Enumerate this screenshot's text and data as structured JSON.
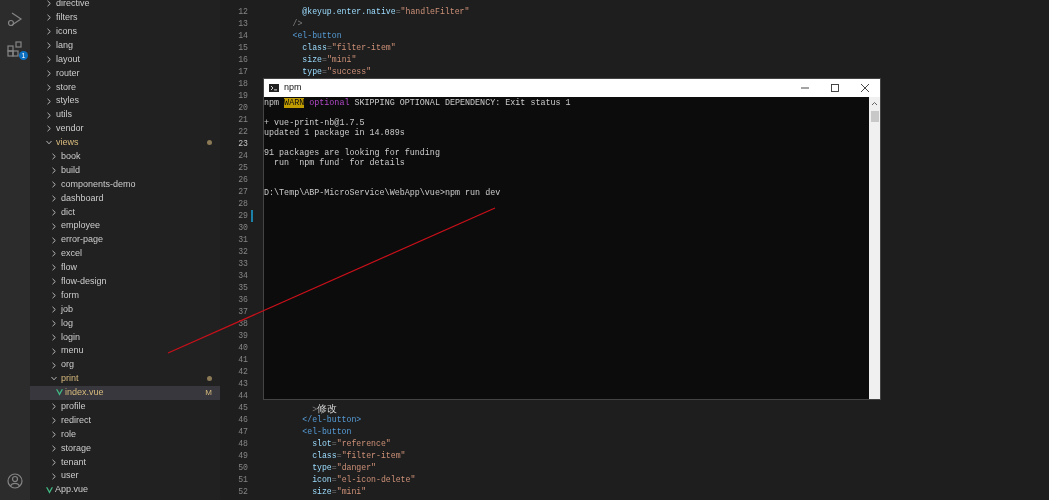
{
  "activity_bar": {
    "extensions_badge": "1"
  },
  "explorer": {
    "items": [
      {
        "kind": "folder",
        "label": "directive",
        "expanded": false,
        "selected": false,
        "modified": false
      },
      {
        "kind": "folder",
        "label": "filters",
        "expanded": false,
        "selected": false,
        "modified": false
      },
      {
        "kind": "folder",
        "label": "icons",
        "expanded": false,
        "selected": false,
        "modified": false
      },
      {
        "kind": "folder",
        "label": "lang",
        "expanded": false,
        "selected": false,
        "modified": false
      },
      {
        "kind": "folder",
        "label": "layout",
        "expanded": false,
        "selected": false,
        "modified": false
      },
      {
        "kind": "folder",
        "label": "router",
        "expanded": false,
        "selected": false,
        "modified": false
      },
      {
        "kind": "folder",
        "label": "store",
        "expanded": false,
        "selected": false,
        "modified": false
      },
      {
        "kind": "folder",
        "label": "styles",
        "expanded": false,
        "selected": false,
        "modified": false
      },
      {
        "kind": "folder",
        "label": "utils",
        "expanded": false,
        "selected": false,
        "modified": false
      },
      {
        "kind": "folder",
        "label": "vendor",
        "expanded": false,
        "selected": false,
        "modified": false
      },
      {
        "kind": "folder",
        "label": "views",
        "expanded": true,
        "selected": false,
        "modified": true,
        "children": [
          {
            "kind": "folder",
            "label": "book",
            "expanded": false,
            "selected": false,
            "modified": false
          },
          {
            "kind": "folder",
            "label": "build",
            "expanded": false,
            "selected": false,
            "modified": false
          },
          {
            "kind": "folder",
            "label": "components-demo",
            "expanded": false,
            "selected": false,
            "modified": false
          },
          {
            "kind": "folder",
            "label": "dashboard",
            "expanded": false,
            "selected": false,
            "modified": false
          },
          {
            "kind": "folder",
            "label": "dict",
            "expanded": false,
            "selected": false,
            "modified": false
          },
          {
            "kind": "folder",
            "label": "employee",
            "expanded": false,
            "selected": false,
            "modified": false
          },
          {
            "kind": "folder",
            "label": "error-page",
            "expanded": false,
            "selected": false,
            "modified": false
          },
          {
            "kind": "folder",
            "label": "excel",
            "expanded": false,
            "selected": false,
            "modified": false
          },
          {
            "kind": "folder",
            "label": "flow",
            "expanded": false,
            "selected": false,
            "modified": false
          },
          {
            "kind": "folder",
            "label": "flow-design",
            "expanded": false,
            "selected": false,
            "modified": false
          },
          {
            "kind": "folder",
            "label": "form",
            "expanded": false,
            "selected": false,
            "modified": false
          },
          {
            "kind": "folder",
            "label": "job",
            "expanded": false,
            "selected": false,
            "modified": false
          },
          {
            "kind": "folder",
            "label": "log",
            "expanded": false,
            "selected": false,
            "modified": false
          },
          {
            "kind": "folder",
            "label": "login",
            "expanded": false,
            "selected": false,
            "modified": false
          },
          {
            "kind": "folder",
            "label": "menu",
            "expanded": false,
            "selected": false,
            "modified": false
          },
          {
            "kind": "folder",
            "label": "org",
            "expanded": false,
            "selected": false,
            "modified": false
          },
          {
            "kind": "folder",
            "label": "print",
            "expanded": true,
            "selected": false,
            "modified": true,
            "children": [
              {
                "kind": "vue_file",
                "label": "index.vue",
                "selected": true,
                "modified": true,
                "git_status": "M"
              }
            ]
          },
          {
            "kind": "folder",
            "label": "profile",
            "expanded": false,
            "selected": false,
            "modified": false
          },
          {
            "kind": "folder",
            "label": "redirect",
            "expanded": false,
            "selected": false,
            "modified": false
          },
          {
            "kind": "folder",
            "label": "role",
            "expanded": false,
            "selected": false,
            "modified": false
          },
          {
            "kind": "folder",
            "label": "storage",
            "expanded": false,
            "selected": false,
            "modified": false
          },
          {
            "kind": "folder",
            "label": "tenant",
            "expanded": false,
            "selected": false,
            "modified": false
          },
          {
            "kind": "folder",
            "label": "user",
            "expanded": false,
            "selected": false,
            "modified": false
          }
        ]
      },
      {
        "kind": "vue_file",
        "label": "App.vue",
        "selected": false,
        "modified": false
      }
    ]
  },
  "editor": {
    "lines": [
      {
        "number": "12",
        "current": false,
        "changed": false,
        "tokens": [
          {
            "text": "        @keyup.enter.native",
            "kind": "attr"
          },
          {
            "text": "=",
            "kind": "punct"
          },
          {
            "text": "\"handleFilter\"",
            "kind": "string"
          }
        ]
      },
      {
        "number": "13",
        "current": false,
        "changed": false,
        "tokens": [
          {
            "text": "      />",
            "kind": "punct"
          }
        ]
      },
      {
        "number": "14",
        "current": false,
        "changed": false,
        "tokens": [
          {
            "text": "      <el-button",
            "kind": "tag"
          }
        ]
      },
      {
        "number": "15",
        "current": false,
        "changed": false,
        "tokens": [
          {
            "text": "        class",
            "kind": "attr"
          },
          {
            "text": "=",
            "kind": "punct"
          },
          {
            "text": "\"filter-item\"",
            "kind": "string"
          }
        ]
      },
      {
        "number": "16",
        "current": false,
        "changed": false,
        "tokens": [
          {
            "text": "        size",
            "kind": "attr"
          },
          {
            "text": "=",
            "kind": "punct"
          },
          {
            "text": "\"mini\"",
            "kind": "string"
          }
        ]
      },
      {
        "number": "17",
        "current": false,
        "changed": false,
        "tokens": [
          {
            "text": "        type",
            "kind": "attr"
          },
          {
            "text": "=",
            "kind": "punct"
          },
          {
            "text": "\"success\"",
            "kind": "string"
          }
        ]
      },
      {
        "number": "18",
        "current": false,
        "changed": false
      },
      {
        "number": "19",
        "current": false,
        "changed": false
      },
      {
        "number": "20",
        "current": false,
        "changed": false
      },
      {
        "number": "21",
        "current": false,
        "changed": false
      },
      {
        "number": "22",
        "current": false,
        "changed": false
      },
      {
        "number": "23",
        "current": true,
        "changed": false
      },
      {
        "number": "24",
        "current": false,
        "changed": false
      },
      {
        "number": "25",
        "current": false,
        "changed": false
      },
      {
        "number": "26",
        "current": false,
        "changed": false
      },
      {
        "number": "27",
        "current": false,
        "changed": false
      },
      {
        "number": "28",
        "current": false,
        "changed": false
      },
      {
        "number": "29",
        "current": false,
        "changed": true
      },
      {
        "number": "30",
        "current": false,
        "changed": false
      },
      {
        "number": "31",
        "current": false,
        "changed": false
      },
      {
        "number": "32",
        "current": false,
        "changed": false
      },
      {
        "number": "33",
        "current": false,
        "changed": false
      },
      {
        "number": "34",
        "current": false,
        "changed": false
      },
      {
        "number": "35",
        "current": false,
        "changed": false
      },
      {
        "number": "36",
        "current": false,
        "changed": false
      },
      {
        "number": "37",
        "current": false,
        "changed": false
      },
      {
        "number": "38",
        "current": false,
        "changed": false
      },
      {
        "number": "39",
        "current": false,
        "changed": false
      },
      {
        "number": "40",
        "current": false,
        "changed": false
      },
      {
        "number": "41",
        "current": false,
        "changed": false
      },
      {
        "number": "42",
        "current": false,
        "changed": false
      },
      {
        "number": "43",
        "current": false,
        "changed": false
      },
      {
        "number": "44",
        "current": false,
        "changed": false
      },
      {
        "number": "45",
        "current": false,
        "changed": false,
        "tokens": [
          {
            "text": "          >",
            "kind": "punct"
          },
          {
            "text": "修改",
            "kind": "text"
          }
        ]
      },
      {
        "number": "46",
        "current": false,
        "changed": false,
        "tokens": [
          {
            "text": "        </el-button>",
            "kind": "tag"
          }
        ]
      },
      {
        "number": "47",
        "current": false,
        "changed": false,
        "tokens": [
          {
            "text": "        <el-button",
            "kind": "tag"
          }
        ]
      },
      {
        "number": "48",
        "current": false,
        "changed": false,
        "tokens": [
          {
            "text": "          slot",
            "kind": "attr"
          },
          {
            "text": "=",
            "kind": "punct"
          },
          {
            "text": "\"reference\"",
            "kind": "string"
          }
        ]
      },
      {
        "number": "49",
        "current": false,
        "changed": false,
        "tokens": [
          {
            "text": "          class",
            "kind": "attr"
          },
          {
            "text": "=",
            "kind": "punct"
          },
          {
            "text": "\"filter-item\"",
            "kind": "string"
          }
        ]
      },
      {
        "number": "50",
        "current": false,
        "changed": false,
        "tokens": [
          {
            "text": "          type",
            "kind": "attr"
          },
          {
            "text": "=",
            "kind": "punct"
          },
          {
            "text": "\"danger\"",
            "kind": "string"
          }
        ]
      },
      {
        "number": "51",
        "current": false,
        "changed": false,
        "tokens": [
          {
            "text": "          icon",
            "kind": "attr"
          },
          {
            "text": "=",
            "kind": "punct"
          },
          {
            "text": "\"el-icon-delete\"",
            "kind": "string"
          }
        ]
      },
      {
        "number": "52",
        "current": false,
        "changed": false,
        "tokens": [
          {
            "text": "          size",
            "kind": "attr"
          },
          {
            "text": "=",
            "kind": "punct"
          },
          {
            "text": "\"mini\"",
            "kind": "string"
          }
        ]
      }
    ]
  },
  "terminal": {
    "title": "npm",
    "lines": [
      {
        "kind": "output",
        "segments": [
          {
            "text": "npm ",
            "kind": "plain"
          },
          {
            "text": "WARN",
            "kind": "warn"
          },
          {
            "text": " optional",
            "kind": "notice"
          },
          {
            "text": " SKIPPING OPTIONAL DEPENDENCY: Exit status 1",
            "kind": "plain"
          }
        ]
      },
      {
        "kind": "blank"
      },
      {
        "kind": "output",
        "segments": [
          {
            "text": "+ vue-print-nb@1.7.5",
            "kind": "plain"
          }
        ]
      },
      {
        "kind": "output",
        "segments": [
          {
            "text": "updated 1 package in 14.089s",
            "kind": "plain"
          }
        ]
      },
      {
        "kind": "blank"
      },
      {
        "kind": "output",
        "segments": [
          {
            "text": "91 packages are looking for funding",
            "kind": "plain"
          }
        ]
      },
      {
        "kind": "output",
        "segments": [
          {
            "text": "  run `npm fund` for details",
            "kind": "plain"
          }
        ]
      },
      {
        "kind": "blank"
      },
      {
        "kind": "blank"
      },
      {
        "kind": "output",
        "segments": [
          {
            "text": "D:\\Temp\\ABP-MicroService\\WebApp\\vue>npm run dev",
            "kind": "plain"
          }
        ]
      }
    ]
  }
}
